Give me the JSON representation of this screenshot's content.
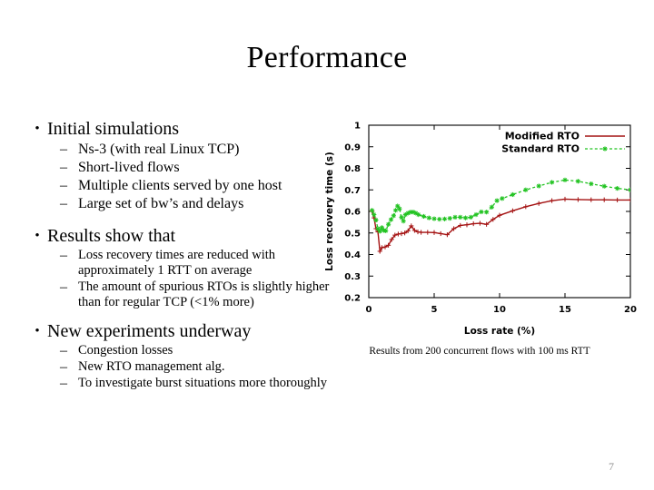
{
  "slide": {
    "title": "Performance",
    "page_number": "7"
  },
  "content": {
    "sections": [
      {
        "bullet_glyph": "•",
        "heading": "Initial simulations",
        "heading_bold": false,
        "sub_size": "normal",
        "items": [
          "Ns-3 (with real Linux TCP)",
          "Short-lived flows",
          "Multiple clients served by one host",
          "Large set of bw’s and delays"
        ]
      },
      {
        "bullet_glyph": "•",
        "heading": "Results show that",
        "heading_bold": false,
        "sub_size": "small",
        "items": [
          "Loss recovery times are reduced with approximately 1 RTT on average",
          "The amount of spurious RTOs is slightly higher than for regular TCP (<1% more)"
        ]
      },
      {
        "bullet_glyph": "•",
        "heading": "New experiments underway",
        "heading_bold": false,
        "sub_size": "small",
        "items": [
          "Congestion losses",
          "New RTO management alg.",
          "To investigate burst situations more thoroughly"
        ]
      }
    ],
    "dash_glyph": "–"
  },
  "chart_caption": "Results from 200 concurrent flows with 100 ms RTT",
  "chart_data": {
    "type": "line",
    "title": "",
    "xlabel": "Loss rate (%)",
    "ylabel": "Loss recovery time (s)",
    "xlim": [
      0,
      20
    ],
    "ylim": [
      0.2,
      1.0
    ],
    "xticks": [
      0,
      5,
      10,
      15,
      20
    ],
    "xtick_labels": [
      "0",
      "5",
      "10",
      "15",
      "20"
    ],
    "yticks": [
      0.2,
      0.3,
      0.4,
      0.5,
      0.6,
      0.7,
      0.8,
      0.9,
      1
    ],
    "ytick_labels": [
      "0.2",
      "0.3",
      "0.4",
      "0.5",
      "0.6",
      "0.7",
      "0.8",
      "0.9",
      "1"
    ],
    "grid": false,
    "legend_position": "top-right",
    "series": [
      {
        "name": "Modified RTO",
        "color": "#a41212",
        "style": "solid",
        "marker": "cross",
        "points": [
          [
            0.25,
            0.6
          ],
          [
            0.4,
            0.57
          ],
          [
            0.55,
            0.52
          ],
          [
            0.7,
            0.505
          ],
          [
            0.85,
            0.415
          ],
          [
            1.0,
            0.432
          ],
          [
            1.25,
            0.435
          ],
          [
            1.5,
            0.443
          ],
          [
            1.75,
            0.47
          ],
          [
            2.0,
            0.49
          ],
          [
            2.25,
            0.495
          ],
          [
            2.5,
            0.497
          ],
          [
            2.75,
            0.5
          ],
          [
            3.0,
            0.51
          ],
          [
            3.25,
            0.533
          ],
          [
            3.5,
            0.512
          ],
          [
            3.75,
            0.505
          ],
          [
            4.0,
            0.503
          ],
          [
            4.5,
            0.503
          ],
          [
            5.0,
            0.502
          ],
          [
            5.5,
            0.497
          ],
          [
            6.0,
            0.492
          ],
          [
            6.5,
            0.52
          ],
          [
            7.0,
            0.535
          ],
          [
            7.5,
            0.538
          ],
          [
            8.0,
            0.543
          ],
          [
            8.5,
            0.545
          ],
          [
            9.0,
            0.54
          ],
          [
            9.5,
            0.563
          ],
          [
            10.0,
            0.582
          ],
          [
            11.0,
            0.603
          ],
          [
            12.0,
            0.622
          ],
          [
            13.0,
            0.637
          ],
          [
            14.0,
            0.65
          ],
          [
            15.0,
            0.657
          ],
          [
            16.0,
            0.655
          ],
          [
            17.0,
            0.654
          ],
          [
            18.0,
            0.654
          ],
          [
            19.0,
            0.653
          ],
          [
            20.0,
            0.653
          ]
        ]
      },
      {
        "name": "Standard RTO",
        "color": "#22c322",
        "style": "dotted",
        "marker": "star",
        "points": [
          [
            0.25,
            0.605
          ],
          [
            0.4,
            0.585
          ],
          [
            0.55,
            0.56
          ],
          [
            0.7,
            0.52
          ],
          [
            0.85,
            0.508
          ],
          [
            1.0,
            0.525
          ],
          [
            1.15,
            0.512
          ],
          [
            1.3,
            0.51
          ],
          [
            1.5,
            0.54
          ],
          [
            1.7,
            0.562
          ],
          [
            1.9,
            0.58
          ],
          [
            2.05,
            0.605
          ],
          [
            2.2,
            0.625
          ],
          [
            2.35,
            0.612
          ],
          [
            2.5,
            0.572
          ],
          [
            2.65,
            0.555
          ],
          [
            2.8,
            0.585
          ],
          [
            3.0,
            0.592
          ],
          [
            3.2,
            0.597
          ],
          [
            3.4,
            0.597
          ],
          [
            3.6,
            0.592
          ],
          [
            3.8,
            0.585
          ],
          [
            4.2,
            0.577
          ],
          [
            4.6,
            0.57
          ],
          [
            5.0,
            0.566
          ],
          [
            5.4,
            0.564
          ],
          [
            5.8,
            0.565
          ],
          [
            6.2,
            0.568
          ],
          [
            6.6,
            0.573
          ],
          [
            7.0,
            0.573
          ],
          [
            7.4,
            0.57
          ],
          [
            7.8,
            0.573
          ],
          [
            8.2,
            0.585
          ],
          [
            8.6,
            0.598
          ],
          [
            9.0,
            0.597
          ],
          [
            9.4,
            0.62
          ],
          [
            9.8,
            0.65
          ],
          [
            10.2,
            0.66
          ],
          [
            11.0,
            0.678
          ],
          [
            12.0,
            0.7
          ],
          [
            13.0,
            0.718
          ],
          [
            14.0,
            0.735
          ],
          [
            15.0,
            0.746
          ],
          [
            16.0,
            0.74
          ],
          [
            17.0,
            0.728
          ],
          [
            18.0,
            0.717
          ],
          [
            19.0,
            0.707
          ],
          [
            20.0,
            0.7
          ]
        ]
      }
    ]
  }
}
